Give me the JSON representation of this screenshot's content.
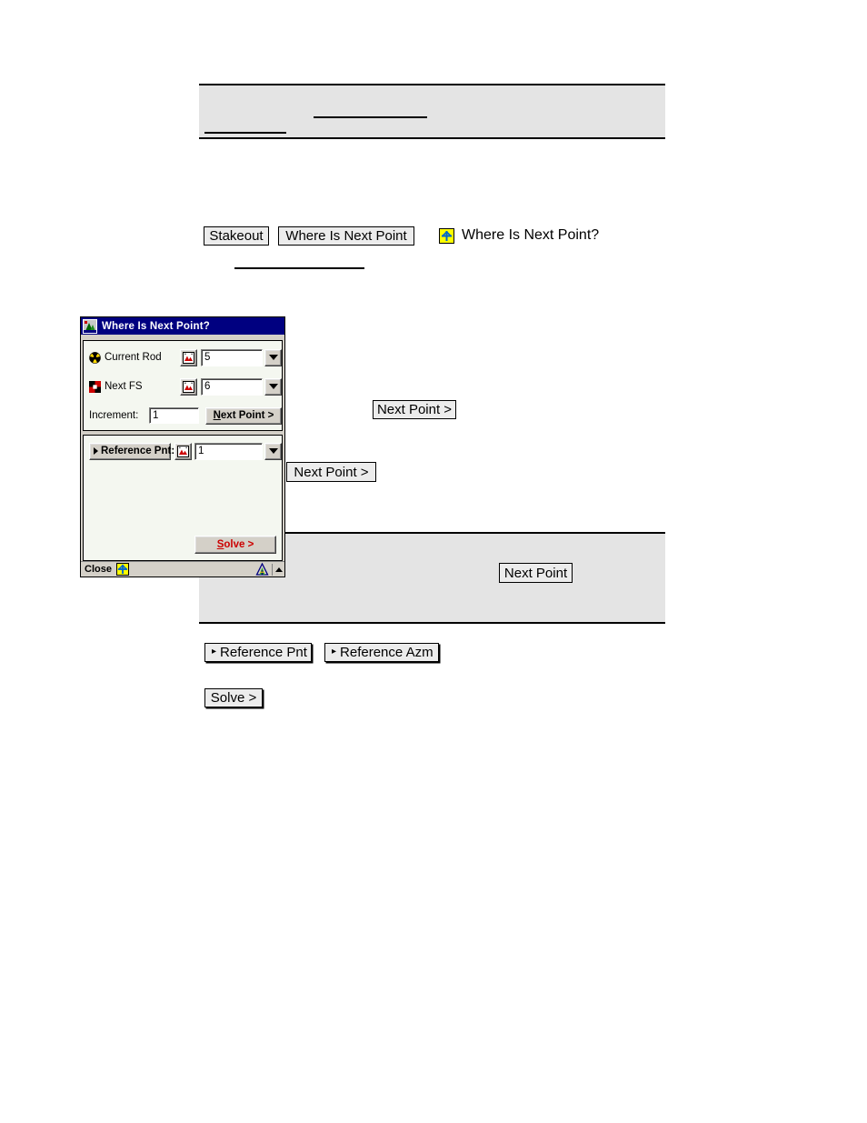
{
  "page": {
    "top_note_panel": {
      "visible": true
    },
    "mid_note_panel": {
      "visible": true
    }
  },
  "doc": {
    "buttons": [
      {
        "name": "stakeout",
        "label": "Stakeout"
      },
      {
        "name": "where-is-next-point",
        "label": "Where Is Next Point"
      },
      {
        "name": "next-point-caret-1",
        "label": "Next Point >"
      },
      {
        "name": "next-point-caret-2",
        "label": "Next Point >"
      },
      {
        "name": "next-point-plain",
        "label": "Next Point"
      },
      {
        "name": "reference-pnt",
        "label": "Reference Pnt",
        "caret": "▸"
      },
      {
        "name": "reference-azm",
        "label": "Reference Azm",
        "caret": "▸"
      },
      {
        "name": "solve",
        "label": "Solve >"
      }
    ],
    "heading": {
      "icon": "yellow-star-icon",
      "label": "Where Is Next Point?"
    }
  },
  "pda": {
    "title": "Where Is Next Point?",
    "title_icon": "app-icon",
    "fields": [
      {
        "name": "current-rod",
        "icon": "radiation-yellow-icon",
        "label": "Current Rod",
        "picker_icon": "map-pick-icon",
        "value": "5",
        "dropdown_icon": "chevron-down-icon"
      },
      {
        "name": "next-fs",
        "icon": "checker-red-icon",
        "label": "Next FS",
        "picker_icon": "map-pick-icon",
        "value": "6",
        "dropdown_icon": "chevron-down-icon"
      }
    ],
    "increment": {
      "label": "Increment:",
      "value": "1"
    },
    "next_point_button": {
      "label_accel": "N",
      "label_rest": "ext Point >"
    },
    "reference": {
      "button_label": "Reference Pnt:",
      "caret": "▸",
      "picker_icon": "map-pick-icon",
      "value": "1",
      "dropdown_icon": "chevron-down-icon"
    },
    "solve_button": {
      "label_accel": "S",
      "label_rest": "olve >"
    },
    "taskbar": {
      "close_label": "Close",
      "star_icon": "yellow-star-icon",
      "tripod_icon": "survey-tripod-icon",
      "up_icon": "chevron-up-icon"
    }
  },
  "colors": {
    "titlebar": "#000080",
    "window_face": "#d4d0c8",
    "group_face": "#f4f7f0",
    "note_panel": "#e4e4e4",
    "accent_red": "#cc0000",
    "star_yellow": "#ffff00",
    "star_blue": "#0066cc"
  }
}
